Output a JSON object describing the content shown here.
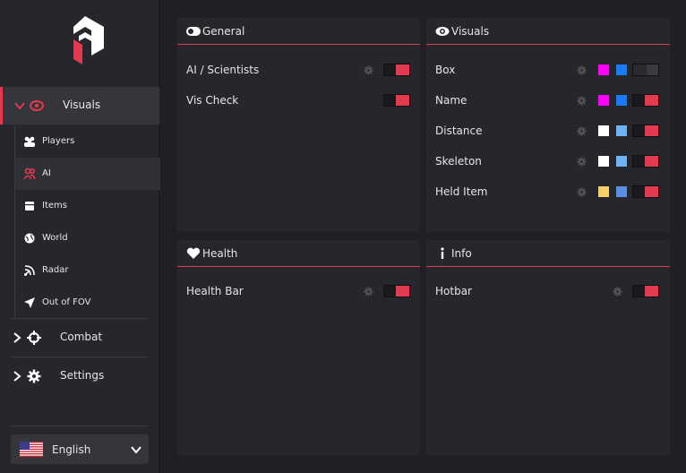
{
  "colors": {
    "accent": "#e23a51",
    "bg": "#1f2024",
    "panel": "#26272c"
  },
  "sidebar": {
    "main_items": [
      {
        "label": "Visuals",
        "icon": "eye-icon",
        "expanded": true,
        "active": true
      },
      {
        "label": "Combat",
        "icon": "crosshair-icon",
        "expanded": false
      },
      {
        "label": "Settings",
        "icon": "gear-icon",
        "expanded": false
      }
    ],
    "sub_items": [
      {
        "label": "Players",
        "icon": "users-icon"
      },
      {
        "label": "AI",
        "icon": "ai-users-icon",
        "active": true
      },
      {
        "label": "Items",
        "icon": "box-icon"
      },
      {
        "label": "World",
        "icon": "globe-icon"
      },
      {
        "label": "Radar",
        "icon": "radar-icon"
      },
      {
        "label": "Out of FOV",
        "icon": "arrow-icon"
      }
    ],
    "language": {
      "label": "English",
      "flag": "us-flag-icon"
    }
  },
  "panels": {
    "general": {
      "title": "General",
      "icon": "toggle-icon",
      "rows": [
        {
          "label": "AI / Scientists",
          "enabled": true
        },
        {
          "label": "Vis Check",
          "enabled": true
        }
      ]
    },
    "visuals": {
      "title": "Visuals",
      "icon": "eye-icon",
      "rows": [
        {
          "label": "Box",
          "color1": "#ff00ff",
          "color2": "#1a7cf5",
          "enabled": false
        },
        {
          "label": "Name",
          "color1": "#ff00ff",
          "color2": "#1a7cf5",
          "enabled": true
        },
        {
          "label": "Distance",
          "color1": "#ffffff",
          "color2": "#6fb4f2",
          "enabled": true
        },
        {
          "label": "Skeleton",
          "color1": "#ffffff",
          "color2": "#6fb4f2",
          "enabled": true
        },
        {
          "label": "Held Item",
          "color1": "#f5d06a",
          "color2": "#5a8fe0",
          "enabled": true
        }
      ]
    },
    "health": {
      "title": "Health",
      "icon": "heart-icon",
      "rows": [
        {
          "label": "Health Bar",
          "enabled": true
        }
      ]
    },
    "info": {
      "title": "Info",
      "icon": "info-icon",
      "rows": [
        {
          "label": "Hotbar",
          "enabled": true
        }
      ]
    }
  }
}
